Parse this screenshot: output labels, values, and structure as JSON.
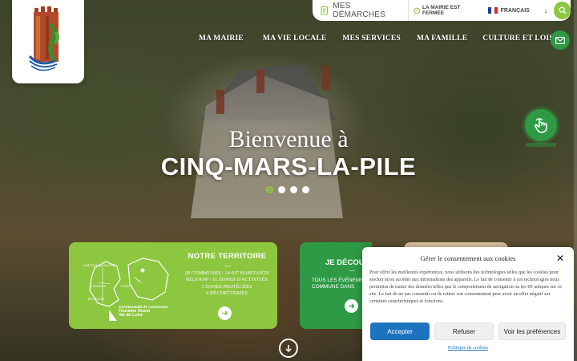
{
  "header": {
    "demarches_label": "MES DÉMARCHES",
    "hours_status": "LA MAIRIE EST FERMÉE",
    "language": "FRANÇAIS"
  },
  "nav": {
    "items": [
      {
        "label": "MA MAIRIE"
      },
      {
        "label": "MA VIE LOCALE"
      },
      {
        "label": "MES SERVICES"
      },
      {
        "label": "MA FAMILLE"
      },
      {
        "label": "CULTURE ET LOISIRS"
      }
    ]
  },
  "hero": {
    "welcome": "Bienvenue à",
    "city": "CINQ-MARS-LA-PILE",
    "slide_count": 4,
    "active_slide": 1
  },
  "cards": {
    "territoire": {
      "title": "NOTRE TERRITOIRE",
      "dash": "—",
      "lines": [
        "28 COMMUNES / 34 037 HABITANTS",
        "802,0 KM² / 11 ZONES D'ACTIVITÉS",
        "3 ZONES PROTÉGÉES",
        "6 DÉCHETTERIES"
      ],
      "map_labels": [
        "CHÂTEAU-LA-VALLIÈRE",
        "LANGEAIS",
        "BOURGUEIL",
        "TOURS"
      ],
      "brand_tagline": "Communauté de communes",
      "brand_name_1": "Touraine Ouest",
      "brand_name_2": "Val de Loire"
    },
    "evenements": {
      "title": "JE DÉCOU",
      "dash": "—",
      "line1": "TOUS LES ÉVÉNEME",
      "line2": "COMMUNE DANS"
    }
  },
  "cookie": {
    "title": "Gérer le consentement aux cookies",
    "body": "Pour offrir les meilleures expériences, nous utilisons des technologies telles que les cookies pour stocker et/ou accéder aux informations des appareils. Le fait de consentir à ces technologies nous permettra de traiter des données telles que le comportement de navigation ou les ID uniques sur ce site. Le fait de ne pas consentir ou de retirer son consentement peut avoir un effet négatif sur certaines caractéristiques et fonctions.",
    "accept": "Accepter",
    "refuse": "Refuser",
    "preferences": "Voir les préférences",
    "policy": "Politique de cookies"
  },
  "colors": {
    "brand_green": "#2e9a45",
    "light_green": "#8dc63f",
    "accept_blue": "#1e73be"
  },
  "icons": {
    "demarches": "document-icon",
    "hours": "clock-icon",
    "language_flag": "french-flag-icon",
    "search": "search-icon",
    "mail": "mail-icon",
    "accessibility": "hand-pointer-icon",
    "scroll": "arrow-down-circle-icon"
  }
}
